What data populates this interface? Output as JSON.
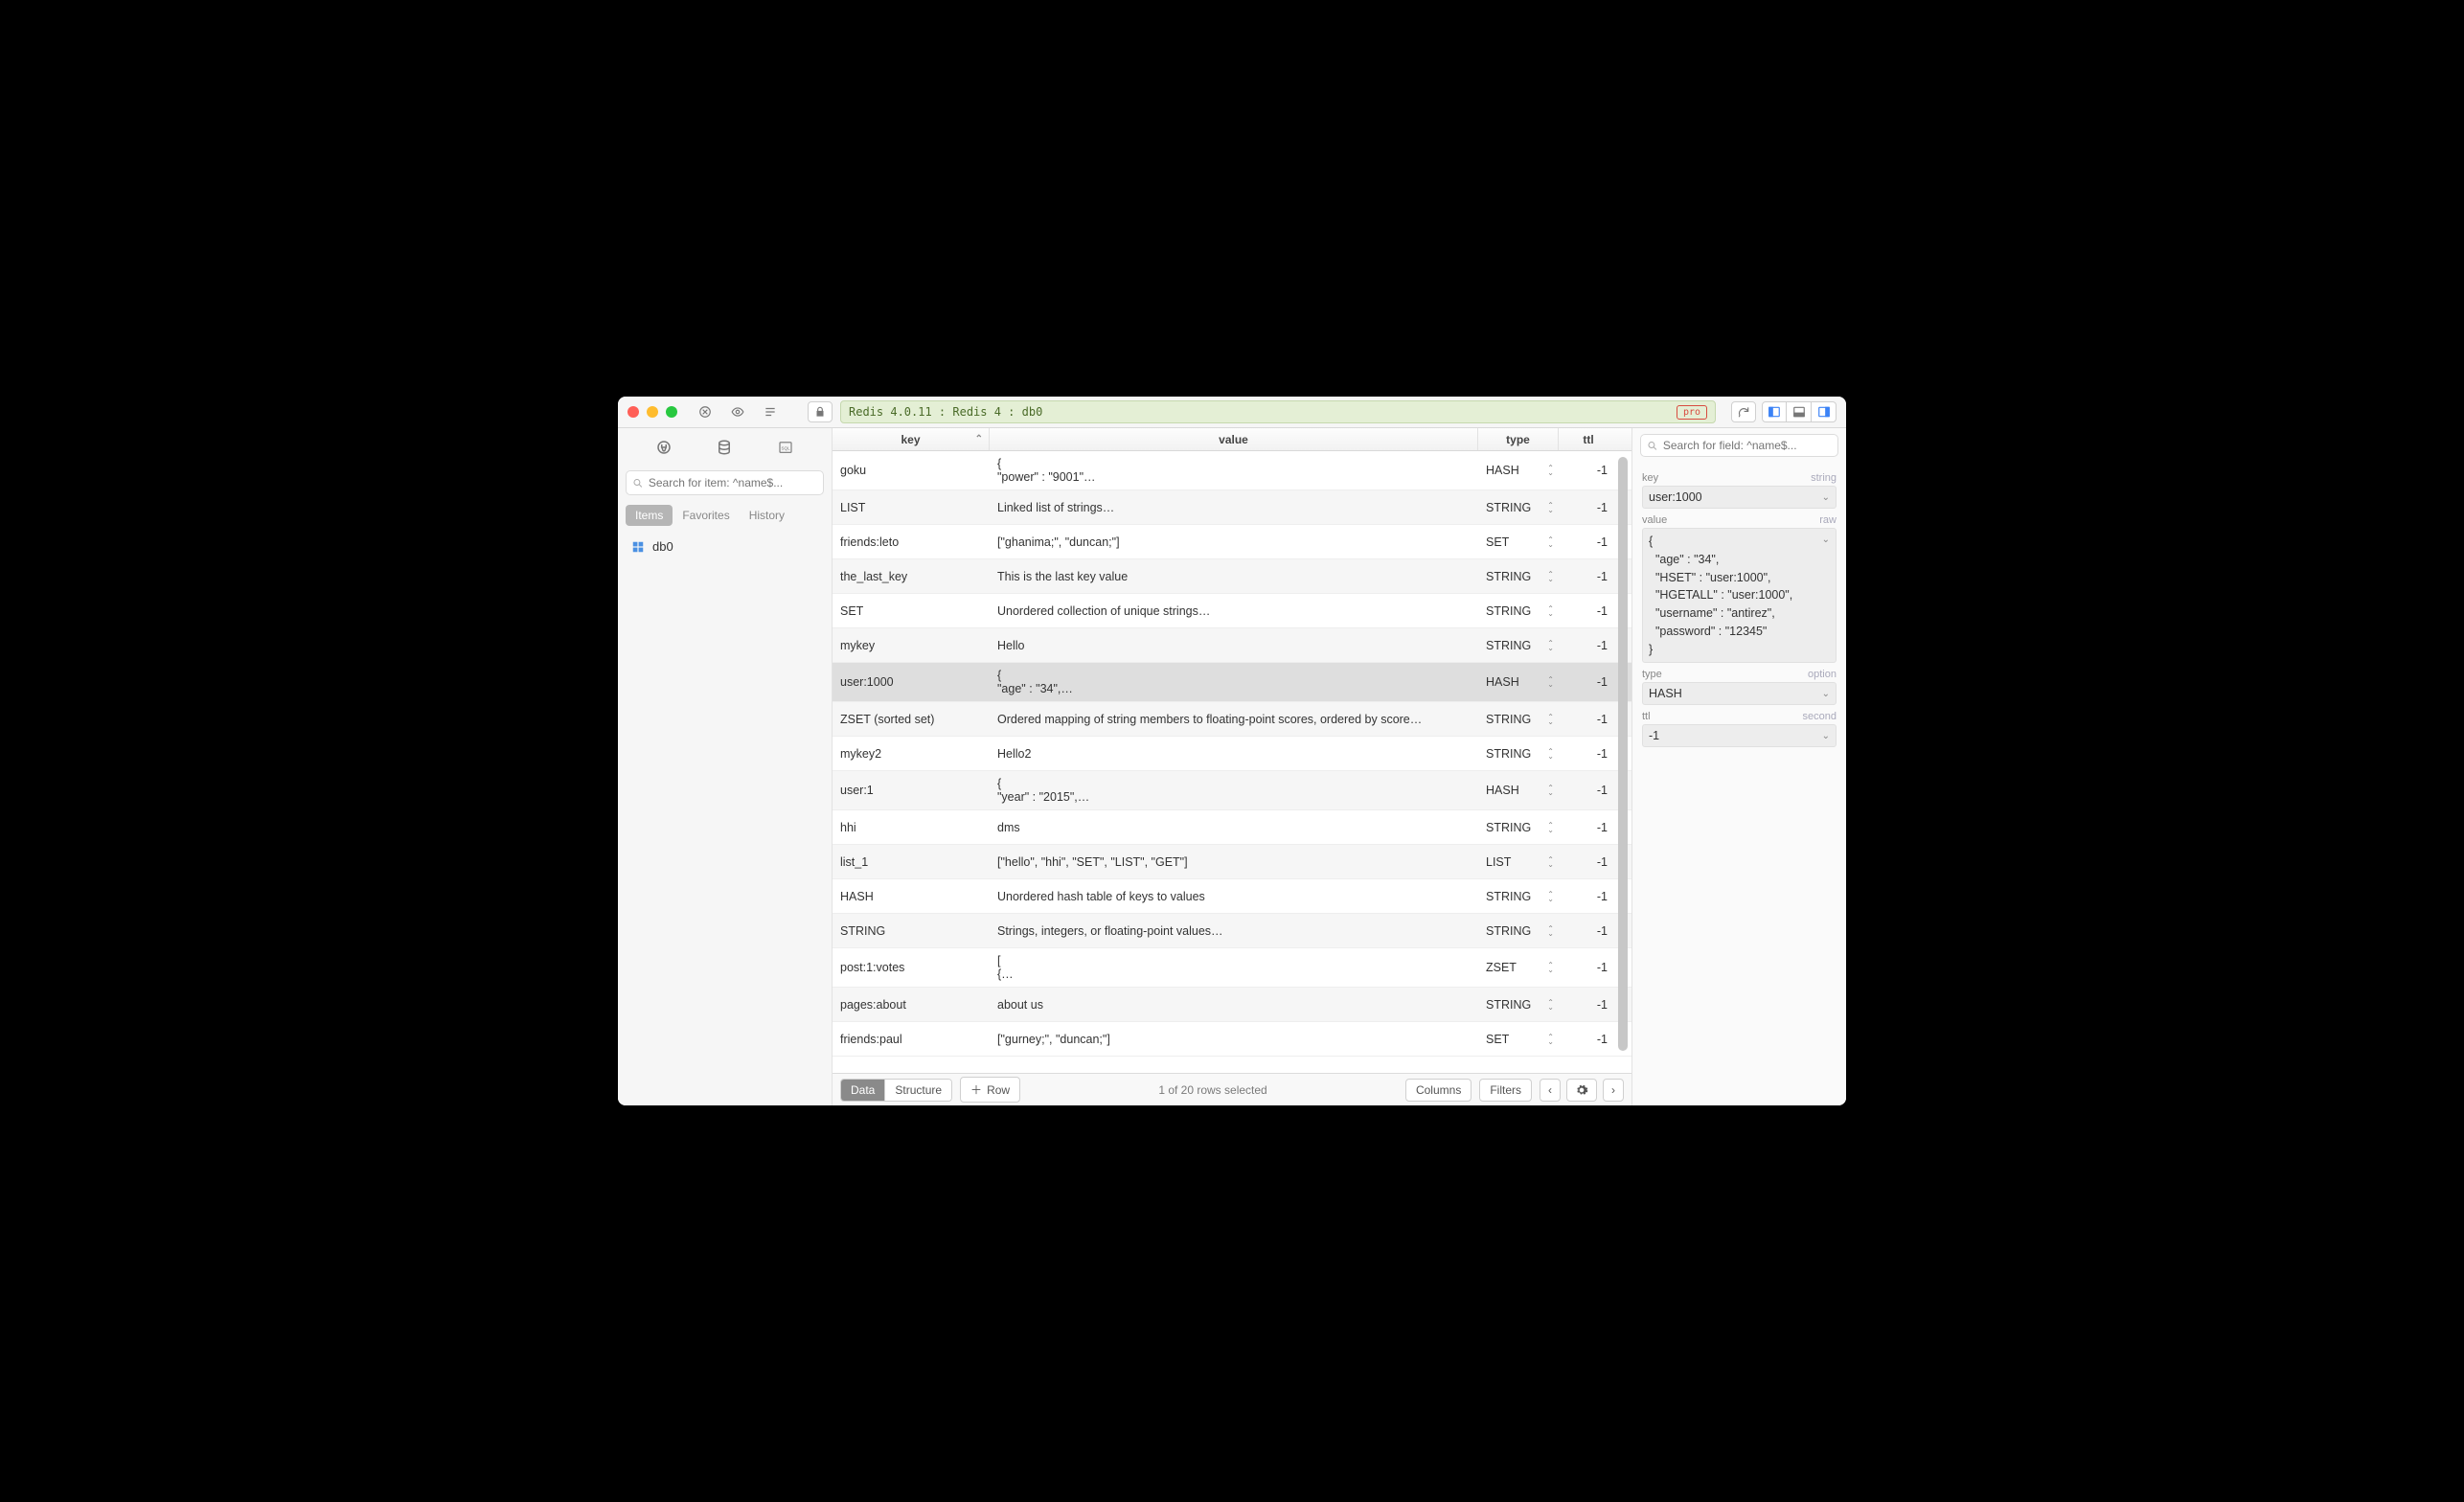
{
  "titlebar": {
    "breadcrumb": "Redis 4.0.11 : Redis 4 : db0",
    "pro_badge": "pro"
  },
  "sidebar": {
    "search_placeholder": "Search for item: ^name$...",
    "tabs": {
      "items": "Items",
      "favorites": "Favorites",
      "history": "History"
    },
    "db_item": "db0"
  },
  "table": {
    "headers": {
      "key": "key",
      "value": "value",
      "type": "type",
      "ttl": "ttl"
    },
    "rows": [
      {
        "key": "goku",
        "value": "{\n  \"power\" : \"9001\"…",
        "type": "HASH",
        "ttl": "-1"
      },
      {
        "key": "LIST",
        "value": "Linked list of strings…",
        "type": "STRING",
        "ttl": "-1"
      },
      {
        "key": "friends:leto",
        "value": "[\"ghanima;\", \"duncan;\"]",
        "type": "SET",
        "ttl": "-1"
      },
      {
        "key": "the_last_key",
        "value": "This is the last key value",
        "type": "STRING",
        "ttl": "-1"
      },
      {
        "key": "SET",
        "value": "Unordered collection of unique strings…",
        "type": "STRING",
        "ttl": "-1"
      },
      {
        "key": "mykey",
        "value": "Hello",
        "type": "STRING",
        "ttl": "-1"
      },
      {
        "key": "user:1000",
        "value": "{\n  \"age\" : \"34\",…",
        "type": "HASH",
        "ttl": "-1",
        "selected": true
      },
      {
        "key": "ZSET (sorted set)",
        "value": "Ordered mapping of string members to floating-point scores, ordered by score…",
        "type": "STRING",
        "ttl": "-1"
      },
      {
        "key": "mykey2",
        "value": "Hello2",
        "type": "STRING",
        "ttl": "-1"
      },
      {
        "key": "user:1",
        "value": "{\n  \"year\" : \"2015\",…",
        "type": "HASH",
        "ttl": "-1"
      },
      {
        "key": "hhi",
        "value": "dms",
        "type": "STRING",
        "ttl": "-1"
      },
      {
        "key": "list_1",
        "value": "[\"hello\", \"hhi\", \"SET\", \"LIST\", \"GET\"]",
        "type": "LIST",
        "ttl": "-1"
      },
      {
        "key": "HASH",
        "value": "Unordered hash table of keys to values",
        "type": "STRING",
        "ttl": "-1"
      },
      {
        "key": "STRING",
        "value": "Strings, integers, or floating-point values…",
        "type": "STRING",
        "ttl": "-1"
      },
      {
        "key": "post:1:votes",
        "value": "[\n  {…",
        "type": "ZSET",
        "ttl": "-1"
      },
      {
        "key": "pages:about",
        "value": "about us",
        "type": "STRING",
        "ttl": "-1"
      },
      {
        "key": "friends:paul",
        "value": "[\"gurney;\", \"duncan;\"]",
        "type": "SET",
        "ttl": "-1"
      }
    ]
  },
  "footer": {
    "tab_data": "Data",
    "tab_structure": "Structure",
    "add_row": "Row",
    "status": "1 of 20 rows selected",
    "columns": "Columns",
    "filters": "Filters"
  },
  "inspector": {
    "search_placeholder": "Search for field: ^name$...",
    "labels": {
      "key": "key",
      "key_hint": "string",
      "value": "value",
      "value_hint": "raw",
      "type": "type",
      "type_hint": "option",
      "ttl": "ttl",
      "ttl_hint": "second"
    },
    "key": "user:1000",
    "value": "{\n  \"age\" : \"34\",\n  \"HSET\" : \"user:1000\",\n  \"HGETALL\" : \"user:1000\",\n  \"username\" : \"antirez\",\n  \"password\" : \"12345\"\n}",
    "type": "HASH",
    "ttl": "-1"
  }
}
